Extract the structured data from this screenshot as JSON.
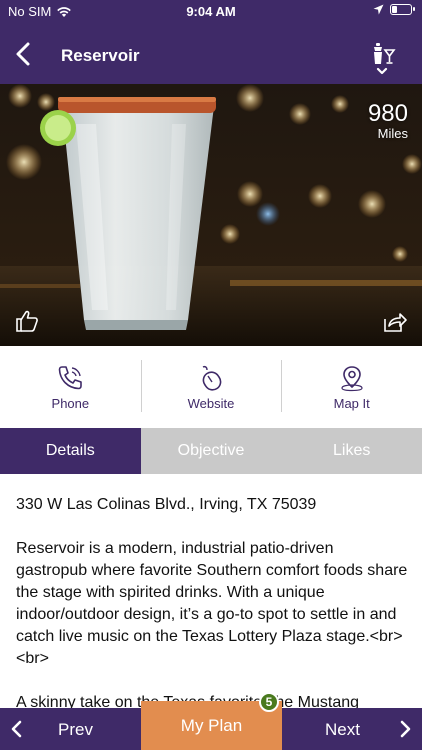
{
  "status_bar": {
    "carrier": "No SIM",
    "time": "9:04 AM",
    "battery_level": 0.3
  },
  "nav": {
    "title": "Reservoir"
  },
  "hero": {
    "distance_value": "980",
    "distance_unit": "Miles"
  },
  "actions": {
    "phone": "Phone",
    "website": "Website",
    "map": "Map It"
  },
  "tabs": [
    "Details",
    "Objective",
    "Likes"
  ],
  "details": {
    "address": "330 W Las Colinas Blvd., Irving, TX 75039",
    "description": "Reservoir is a modern, industrial patio-driven gastropub where favorite Southern comfort foods share the stage with spirited drinks. With a unique indoor/outdoor design, it’s a go-to spot to settle in and catch live music on the Texas Lottery Plaza stage.<br><br>",
    "partial_line": "A skinny take on the Texas favorite, the Mustang"
  },
  "bottom": {
    "prev": "Prev",
    "my_plan": "My Plan",
    "next": "Next",
    "plan_count": "5"
  },
  "colors": {
    "primary": "#3f2a68",
    "accent": "#e28d4f",
    "badge": "#4a7a1e",
    "tab_inactive": "#c9c9c9"
  }
}
